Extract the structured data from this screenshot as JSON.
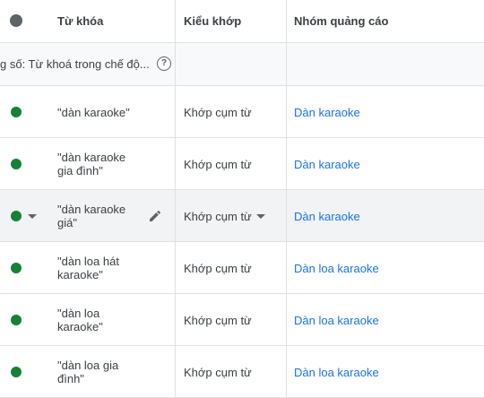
{
  "header": {
    "keyword_col": "Từ khóa",
    "match_col": "Kiểu khớp",
    "group_col": "Nhóm quảng cáo"
  },
  "filter": {
    "text": "g số: Từ khoá trong chế độ..."
  },
  "icons": {
    "status_header": "status-dot-icon",
    "help": "help-circle-icon",
    "status_enabled": "green-dot-icon",
    "dropdown": "caret-down-icon",
    "edit": "pencil-icon"
  },
  "colors": {
    "enabled": "#188038",
    "link": "#1a73e8",
    "header_dot": "#5f6368"
  },
  "rows": [
    {
      "keyword": "\"dàn karaoke\"",
      "match": "Khớp cụm từ",
      "group": "Dàn karaoke"
    },
    {
      "keyword": "\"dàn karaoke gia đình\"",
      "match": "Khớp cụm từ",
      "group": "Dàn karaoke"
    },
    {
      "keyword": "\"dàn karaoke giá\"",
      "match": "Khớp cụm từ",
      "group": "Dàn karaoke"
    },
    {
      "keyword": "\"dàn loa hát karaoke\"",
      "match": "Khớp cụm từ",
      "group": "Dàn loa karaoke"
    },
    {
      "keyword": "\"dàn loa karaoke\"",
      "match": "Khớp cụm từ",
      "group": "Dàn loa karaoke"
    },
    {
      "keyword": "\"dàn loa gia đình\"",
      "match": "Khớp cụm từ",
      "group": "Dàn loa karaoke"
    }
  ]
}
